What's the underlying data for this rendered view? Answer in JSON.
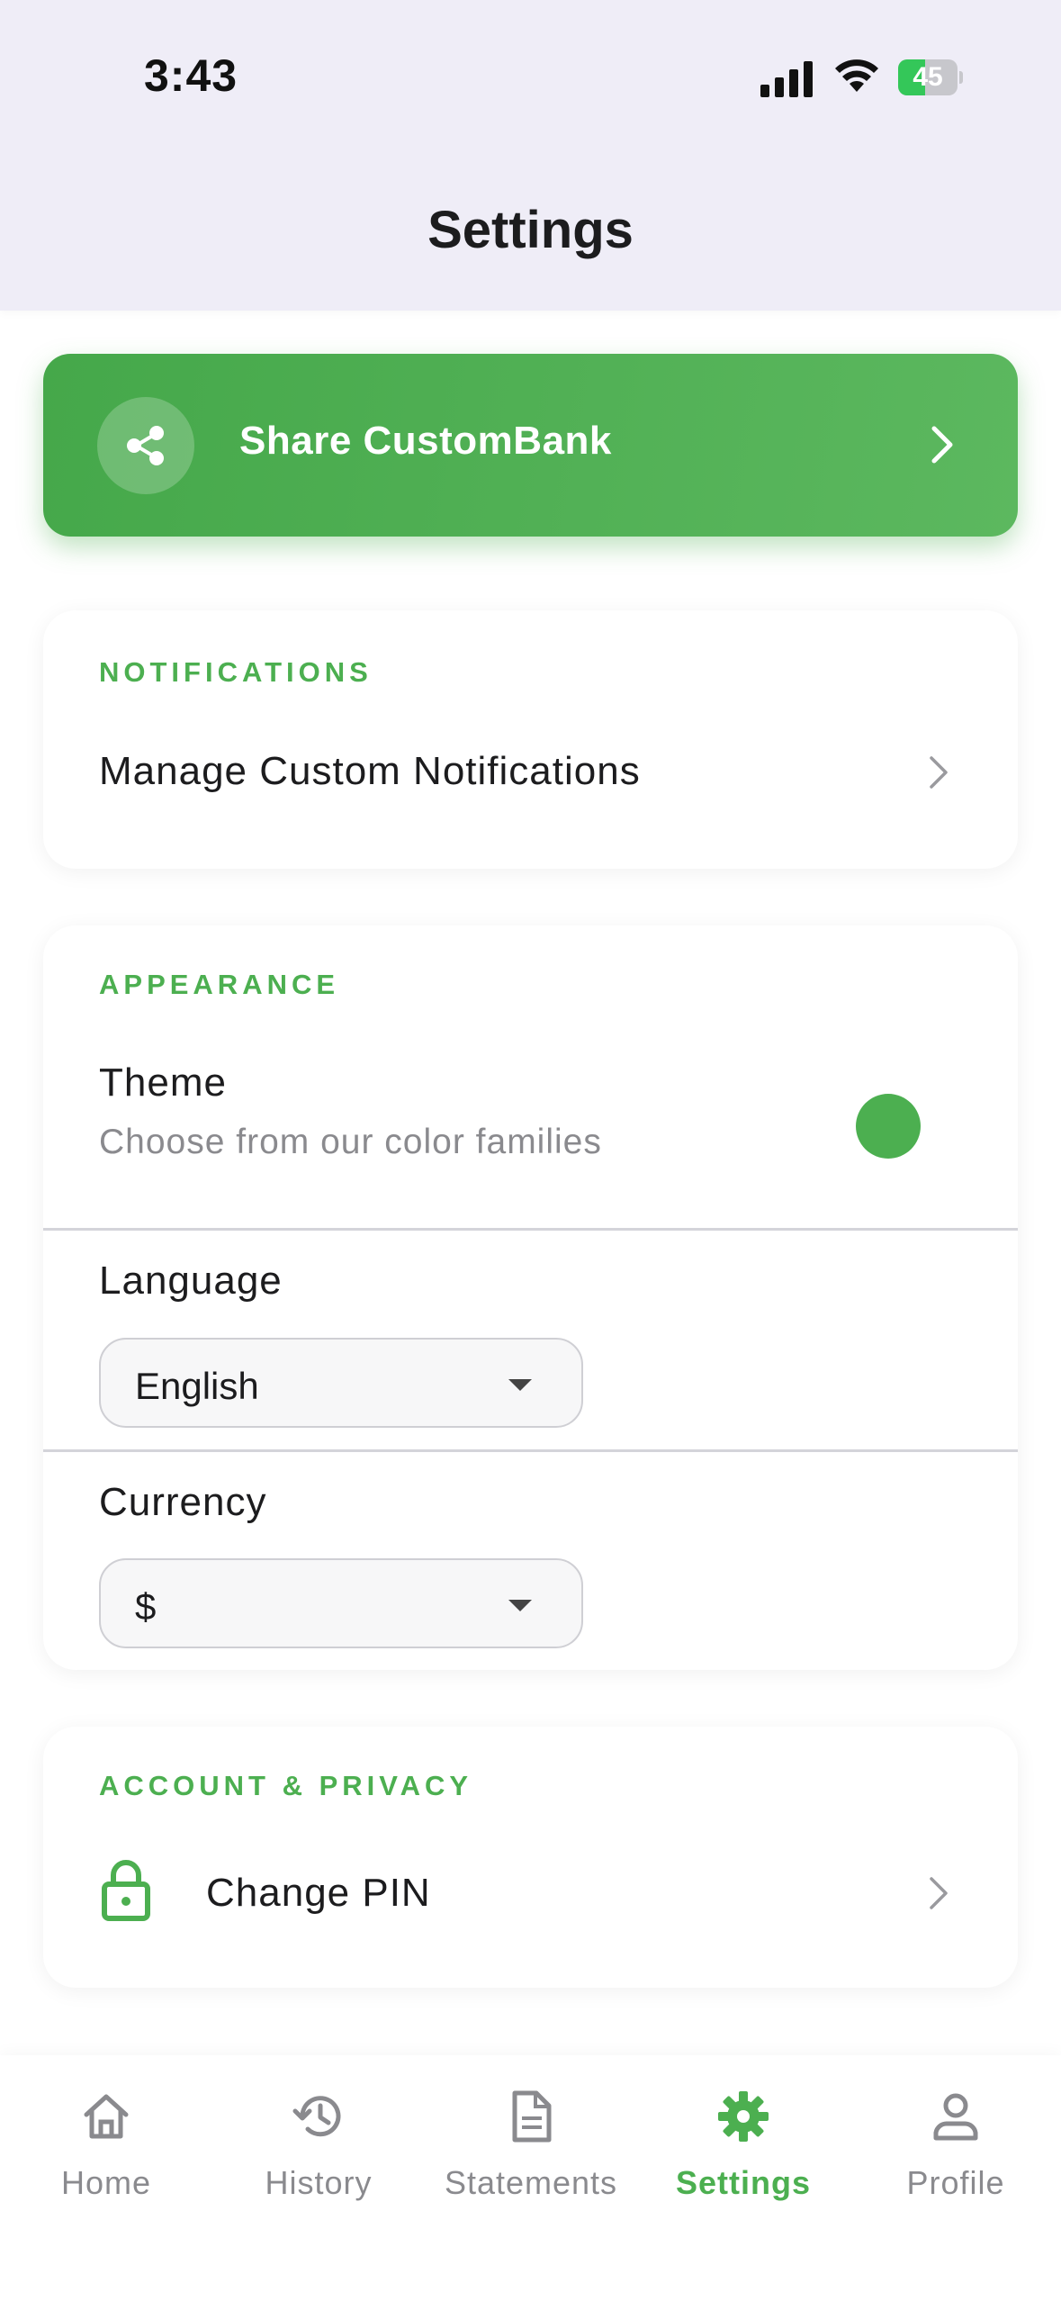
{
  "status_bar": {
    "time": "3:43",
    "battery": "45",
    "battery_level": 0.45
  },
  "header": {
    "title": "Settings"
  },
  "share": {
    "label": "Share CustomBank",
    "icon": "share-icon"
  },
  "notifications": {
    "section_title": "NOTIFICATIONS",
    "manage_label": "Manage Custom Notifications"
  },
  "appearance": {
    "section_title": "APPEARANCE",
    "theme_label": "Theme",
    "theme_sub": "Choose from our color families",
    "theme_color": "#4caf50",
    "language_label": "Language",
    "language_value": "English",
    "currency_label": "Currency",
    "currency_value": "$"
  },
  "account": {
    "section_title": "ACCOUNT & PRIVACY",
    "change_pin_label": "Change PIN",
    "icon": "lock-icon"
  },
  "tabs": [
    {
      "label": "Home",
      "icon": "home-icon",
      "active": false
    },
    {
      "label": "History",
      "icon": "history-icon",
      "active": false
    },
    {
      "label": "Statements",
      "icon": "document-icon",
      "active": false
    },
    {
      "label": "Settings",
      "icon": "gear-icon",
      "active": true
    },
    {
      "label": "Profile",
      "icon": "person-icon",
      "active": false
    }
  ],
  "colors": {
    "accent": "#4caf50",
    "header_bg": "#efedf7",
    "inactive": "#8a8a8e"
  }
}
